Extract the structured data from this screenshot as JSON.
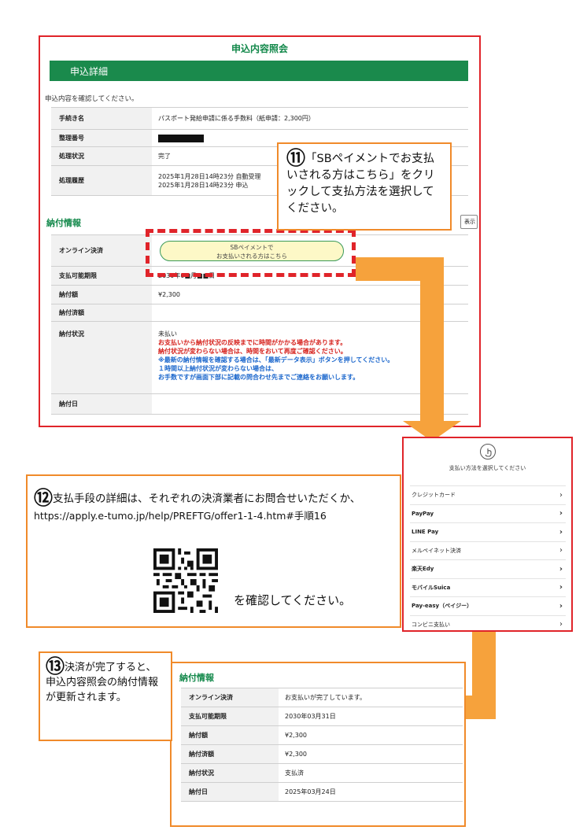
{
  "top": {
    "page_title": "申込内容照会",
    "section_title": "申込詳細",
    "instruction": "申込内容を確認してください。",
    "detail_rows": [
      {
        "label": "手続き名",
        "value": "パスポート発給申請に係る手数料（紙申請：2,300円）"
      },
      {
        "label": "整理番号",
        "value": ""
      },
      {
        "label": "処理状況",
        "value": "完了"
      },
      {
        "label": "処理履歴",
        "value_line1": "2025年1月28日14時23分 自動受理",
        "value_line2": "2025年1月28日14時23分 申込"
      }
    ],
    "payment_title": "納付情報",
    "latest_button": "表示",
    "payment_rows": {
      "online_label": "オンライン決済",
      "sb_button_line1": "SBペイメントで",
      "sb_button_line2": "お支払いされる方はこちら",
      "deadline_label": "支払可能期限",
      "deadline_value": "2030年0■月■■日",
      "amount_label": "納付額",
      "amount_value": "¥2,300",
      "paid_label": "納付済額",
      "paid_value": "",
      "status_label": "納付状況",
      "status_value": "未払い",
      "notice_red_1": "お支払いから納付状況の反映までに時間がかかる場合があります。",
      "notice_red_2": "納付状況が変わらない場合は、時間をおいて再度ご確認ください。",
      "notice_blue_1": "※最新の納付情報を確認する場合は、「最新データ表示」ボタンを押してください。",
      "notice_blue_2": "１時間以上納付状況が変わらない場合は、",
      "notice_blue_3": "お手数ですが画面下部に記載の問合わせ先までご連絡をお願いします。",
      "date_label": "納付日",
      "date_value": ""
    }
  },
  "callout11": {
    "num": "⑪",
    "text": "「SBペイメントでお支払いされる方はこちら」をクリックして支払方法を選択してください。"
  },
  "callout12": {
    "num": "⑫",
    "text": "支払手段の詳細は、それぞれの決済業者にお問合せいただくか、",
    "url": "https://apply.e-tumo.jp/help/PREFTG/offer1-1-4.htm#手順16",
    "confirm": "を確認してください。"
  },
  "callout13": {
    "num": "⑬",
    "text": "決済が完了すると、申込内容照会の納付情報が更新されます。"
  },
  "methods": {
    "heading": "支払い方法を選択してください",
    "items": [
      "クレジットカード",
      "PayPay",
      "LINE Pay",
      "メルペイネット決済",
      "楽天Edy",
      "モバイルSuica",
      "Pay-easy（ペイジー）",
      "コンビニ支払い"
    ]
  },
  "bottom": {
    "title": "納付情報",
    "rows": [
      {
        "label": "オンライン決済",
        "value": "お支払いが完了しています。"
      },
      {
        "label": "支払可能期限",
        "value": "2030年03月31日"
      },
      {
        "label": "納付額",
        "value": "¥2,300"
      },
      {
        "label": "納付済額",
        "value": "¥2,300"
      },
      {
        "label": "納付状況",
        "value": "支払済"
      },
      {
        "label": "納付日",
        "value": "2025年03月24日"
      }
    ]
  },
  "colors": {
    "green": "#12884a",
    "red": "#e0242a",
    "orange": "#f6a23c"
  }
}
